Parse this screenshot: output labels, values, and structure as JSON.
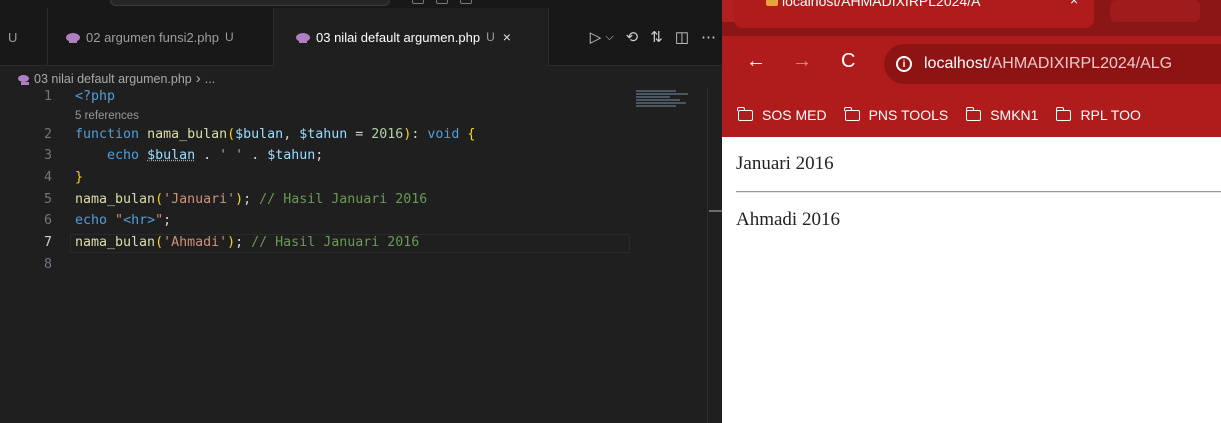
{
  "editor": {
    "tabs": [
      {
        "label": "U",
        "active": false
      },
      {
        "label": "02 argumen funsi2.php",
        "badge": "U",
        "active": false
      },
      {
        "label": "03 nilai default argumen.php",
        "badge": "U",
        "active": true
      }
    ],
    "tab_close_glyph": "×",
    "breadcrumb": {
      "file": "03 nilai default argumen.php",
      "tail": "..."
    },
    "codelens": "5 references",
    "line_numbers": [
      "1",
      "2",
      "3",
      "4",
      "5",
      "6",
      "7",
      "8"
    ],
    "current_line": "7",
    "colors": {
      "background": "#1f1f1f",
      "keyword": "#569cd6",
      "function": "#dcdcaa",
      "variable": "#9cdcfe",
      "string": "#ce9178",
      "number": "#b5cea8",
      "comment": "#6a9955"
    },
    "code": {
      "l1": "<?php",
      "l2_kw": "function",
      "l2_fn": "nama_bulan",
      "l2_var1": "$bulan",
      "l2_var2": "$tahun",
      "l2_num": "2016",
      "l2_type": "void",
      "l3_kw": "echo",
      "l3_var1": "$bulan",
      "l3_str": "' '",
      "l3_var2": "$tahun",
      "l5_fn": "nama_bulan",
      "l5_str": "'Januari'",
      "l5_cmt": "// Hasil Januari 2016",
      "l6_kw": "echo",
      "l6_str_open": "\"",
      "l6_tag": "<hr>",
      "l6_str_close": "\"",
      "l7_fn": "nama_bulan",
      "l7_str": "'Ahmadi'",
      "l7_cmt": "// Hasil Januari 2016"
    },
    "actions": [
      "run-icon",
      "chevron-down-icon",
      "history-icon",
      "source-control-icon",
      "split-editor-icon",
      "more-icon"
    ]
  },
  "browser": {
    "tab_title": "localhost/AHMADIXIRPL2024/A",
    "tab_close_glyph": "×",
    "url_host": "localhost",
    "url_path": "/AHMADIXIRPL2024/ALG",
    "bookmarks": [
      "SOS MED",
      "PNS TOOLS",
      "SMKN1",
      "RPL TOO"
    ],
    "theme_color": "#b01c1c",
    "output": {
      "line1": "Januari 2016",
      "line2": "Ahmadi 2016"
    }
  }
}
